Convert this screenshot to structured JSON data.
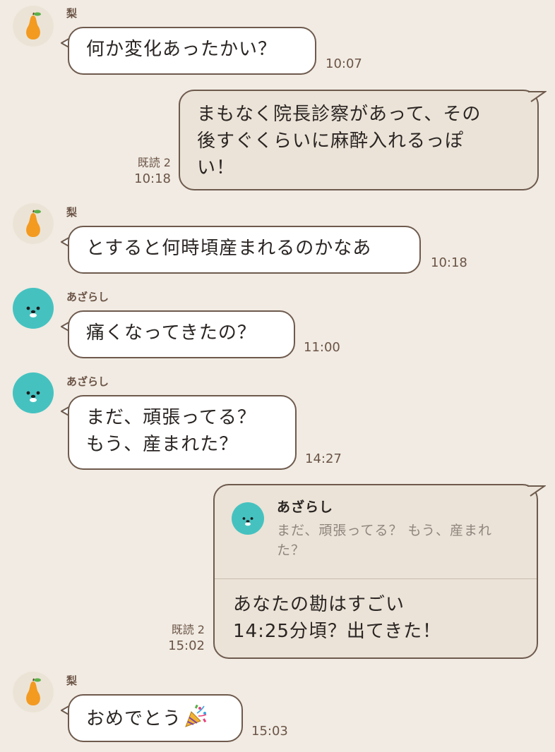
{
  "colors": {
    "background": "#f1ebe3",
    "incoming_bubble": "#ffffff",
    "outgoing_bubble": "#ebe3d7",
    "border": "#6e5a4d",
    "meta_text": "#6b5446",
    "seal_avatar": "#45c2c0"
  },
  "messages": [
    {
      "sender": "梨",
      "avatar": "pear-icon",
      "text": "何か変化あったかい？",
      "time": "10:07"
    },
    {
      "outgoing": true,
      "lines": [
        "まもなく院長診察があって、その",
        "後すぐくらいに麻酔入れるっぽ",
        "い！"
      ],
      "read": "既読 2",
      "time": "10:18"
    },
    {
      "sender": "梨",
      "avatar": "pear-icon",
      "text": "とすると何時頃産まれるのかなあ",
      "time": "10:18"
    },
    {
      "sender": "あざらし",
      "avatar": "seal-icon",
      "text": "痛くなってきたの？",
      "time": "11:00"
    },
    {
      "sender": "あざらし",
      "avatar": "seal-icon",
      "lines": [
        "まだ、頑張ってる？",
        "もう、産まれた？"
      ],
      "time": "14:27"
    },
    {
      "outgoing": true,
      "reply_to": {
        "sender": "あざらし",
        "lines": [
          "まだ、頑張ってる？ もう、産まれ",
          "た？"
        ]
      },
      "lines": [
        "あなたの勘はすごい",
        "14:25分頃？出てきた！"
      ],
      "read": "既読 2",
      "time": "15:02"
    },
    {
      "sender": "梨",
      "avatar": "pear-icon",
      "text": "おめでとう",
      "emoji": "party-popper-icon",
      "time": "15:03"
    }
  ]
}
